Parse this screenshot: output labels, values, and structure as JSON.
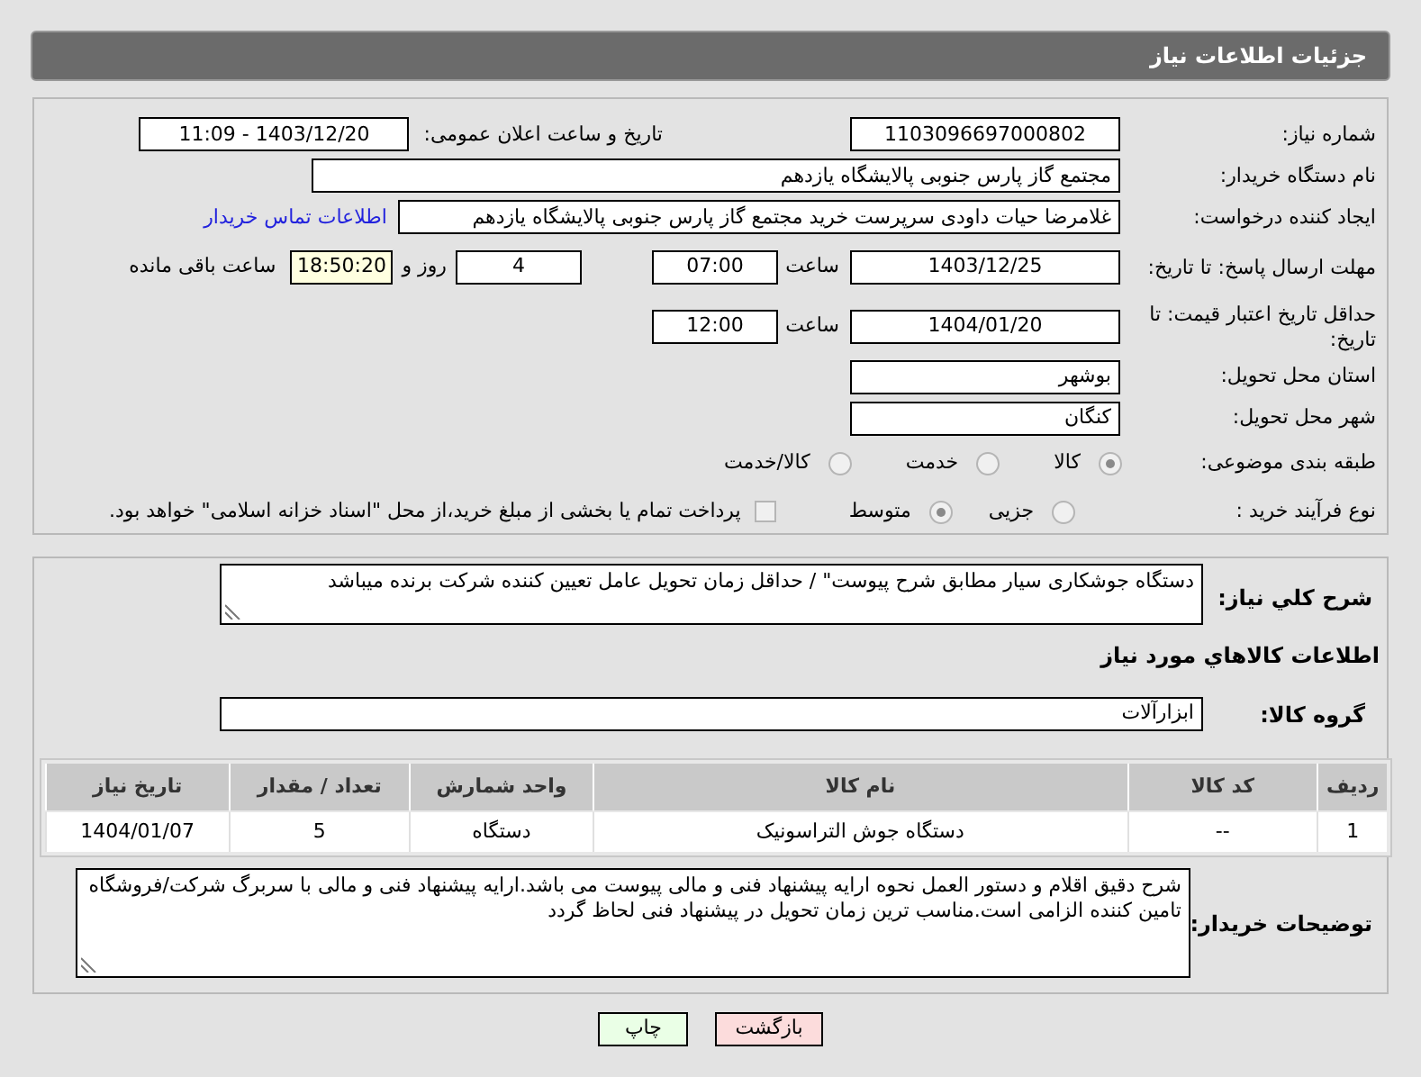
{
  "header": {
    "title": "جزئیات اطلاعات نیاز"
  },
  "details": {
    "need_number": {
      "label": "شماره نیاز:",
      "value": "1103096697000802"
    },
    "announce": {
      "label": "تاریخ و ساعت اعلان عمومی:",
      "value": "1403/12/20 - 11:09"
    },
    "buyer": {
      "label": "نام دستگاه خریدار:",
      "value": "مجتمع گاز پارس جنوبی  پالایشگاه یازدهم"
    },
    "creator": {
      "label": "ایجاد کننده درخواست:",
      "value": "غلامرضا حیات داودی سرپرست خرید مجتمع گاز پارس جنوبی  پالایشگاه یازدهم",
      "link": "اطلاعات تماس خریدار"
    },
    "response_deadline": {
      "label": "مهلت ارسال پاسخ: تا تاریخ:",
      "date": "1403/12/25",
      "time_label": "ساعت",
      "time": "07:00",
      "days": "4",
      "days_label": "روز و",
      "remaining": "18:50:20",
      "remaining_label": "ساعت باقی مانده"
    },
    "price_validity": {
      "label": "حداقل تاریخ اعتبار قیمت: تا تاریخ:",
      "date": "1404/01/20",
      "time_label": "ساعت",
      "time": "12:00"
    },
    "province": {
      "label": "استان محل تحویل:",
      "value": "بوشهر"
    },
    "city": {
      "label": "شهر محل تحویل:",
      "value": "کنگان"
    },
    "category": {
      "label": "طبقه بندی موضوعی:",
      "options": [
        {
          "label": "کالا",
          "selected": true
        },
        {
          "label": "خدمت",
          "selected": false
        },
        {
          "label": "کالا/خدمت",
          "selected": false
        }
      ]
    },
    "process": {
      "label": "نوع فرآیند خرید :",
      "options": [
        {
          "label": "جزیی",
          "selected": false
        },
        {
          "label": "متوسط",
          "selected": true
        }
      ],
      "treasury": {
        "label": "پرداخت تمام یا بخشی از مبلغ خرید،از محل \"اسناد خزانه اسلامی\" خواهد بود.",
        "checked": false
      }
    }
  },
  "general_description": {
    "label": "شرح کلي نیاز:",
    "value": "دستگاه جوشکاری سیار مطابق شرح پیوست\" / حداقل زمان تحویل عامل تعیین کننده شرکت برنده میباشد"
  },
  "goods_title": "اطلاعات کالاهاي مورد نیاز",
  "goods_group": {
    "label": "گروه کالا:",
    "value": "ابزارآلات"
  },
  "table": {
    "columns": [
      "ردیف",
      "کد کالا",
      "نام کالا",
      "واحد شمارش",
      "تعداد / مقدار",
      "تاریخ نیاز"
    ],
    "rows": [
      [
        "1",
        "--",
        "دستگاه جوش التراسونیک",
        "دستگاه",
        "5",
        "1404/01/07"
      ]
    ]
  },
  "buyer_notes": {
    "label": "توضیحات خریدار:",
    "value": "شرح دقیق اقلام و دستور العمل نحوه ارایه پیشنهاد فنی و مالی پیوست می باشد.ارایه پیشنهاد فنی و مالی با سربرگ شرکت/فروشگاه تامین کننده الزامی است.مناسب ترین زمان تحویل در پیشنهاد فنی لحاظ گردد"
  },
  "buttons": [
    {
      "label": "بازگشت",
      "kind": "back"
    },
    {
      "label": "چاپ",
      "kind": "print"
    }
  ]
}
